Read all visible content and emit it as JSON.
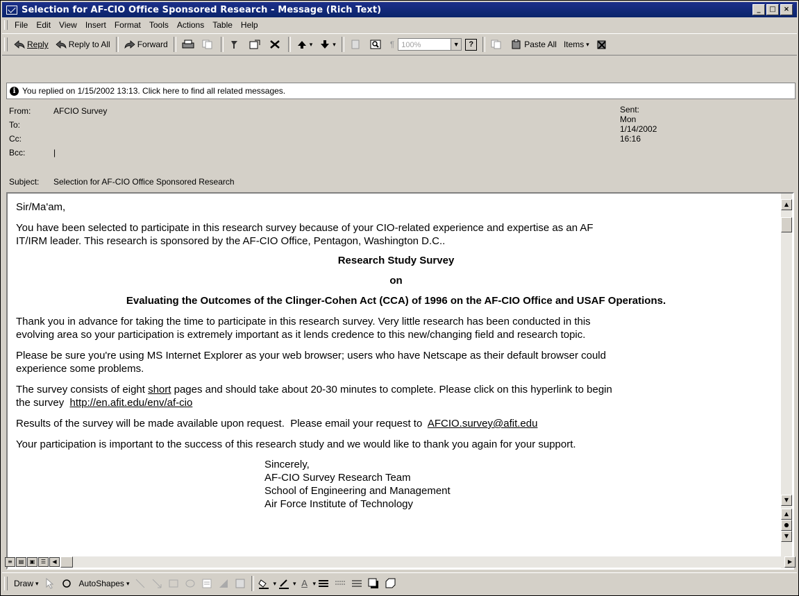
{
  "window": {
    "title": "Selection for AF-CIO Office Sponsored Research - Message (Rich Text)",
    "buttons": [
      "_",
      "□",
      "×"
    ]
  },
  "menubar": {
    "items": [
      {
        "label": "File",
        "accel": "F"
      },
      {
        "label": "Edit",
        "accel": "E"
      },
      {
        "label": "View",
        "accel": "V"
      },
      {
        "label": "Insert",
        "accel": "I"
      },
      {
        "label": "Format",
        "accel": "o"
      },
      {
        "label": "Tools",
        "accel": "T"
      },
      {
        "label": "Actions",
        "accel": "A"
      },
      {
        "label": "Table",
        "accel": "a"
      },
      {
        "label": "Help",
        "accel": "H"
      }
    ]
  },
  "toolbar": {
    "reply": "Reply",
    "reply_all": "Reply to All",
    "forward": "Forward",
    "zoom": "100%",
    "paste_all": "Paste All",
    "items": "Items",
    "help_glyph": "?"
  },
  "infobar": {
    "text": "You replied on 1/15/2002 13:13. Click here to find all related messages."
  },
  "header": {
    "from_label": "From:",
    "from_value": "AFCIO Survey",
    "sent_label": "Sent:",
    "sent_value": "Mon 1/14/2002 16:16",
    "to_label": "To:",
    "cc_label": "Cc:",
    "bcc_label": "Bcc:",
    "bcc_value": "|",
    "subject_label": "Subject:",
    "subject_value": "Selection for AF-CIO Office Sponsored Research"
  },
  "body": {
    "greeting": "Sir/Ma'am,",
    "p1a": "You have been selected to participate in this research survey because of your CIO-related experience and expertise as an AF",
    "p1b": "IT/IRM leader.  This research is sponsored by the AF-CIO Office, Pentagon, Washington D.C..",
    "title1": "Research Study Survey",
    "title2": "on",
    "title3": "Evaluating the Outcomes of the Clinger-Cohen Act (CCA) of 1996 on the AF-CIO Office and USAF Operations.",
    "p2a": "Thank you in advance for taking the time to participate in this research survey.  Very little research has been conducted in this",
    "p2b": "evolving area so your participation is extremely important as it lends credence to this new/changing field and research topic.",
    "p3a": "Please be sure you're using MS Internet Explorer as your web browser; users who have Netscape as their default browser could",
    "p3b": "experience some problems.",
    "p4a_pre": "The survey consists of eight ",
    "p4a_short": "short",
    "p4a_post": " pages and should take about 20-30 minutes to complete.  Please click on this hyperlink to begin",
    "p4b_pre": "the survey  ",
    "p4b_link": "http://en.afit.edu/env/af-cio",
    "p5_pre": "Results of the survey will be made available upon request.  Please email your request to  ",
    "p5_link": "AFCIO.survey@afit.edu",
    "p6": "Your participation is important to the success of this research study and we would like to thank you again for your support.",
    "sig1": "Sincerely,",
    "sig2": "AF-CIO Survey Research Team",
    "sig3": "School of Engineering and Management",
    "sig4": "Air Force Institute of Technology"
  },
  "drawbar": {
    "draw": "Draw",
    "autoshapes": "AutoShapes"
  }
}
